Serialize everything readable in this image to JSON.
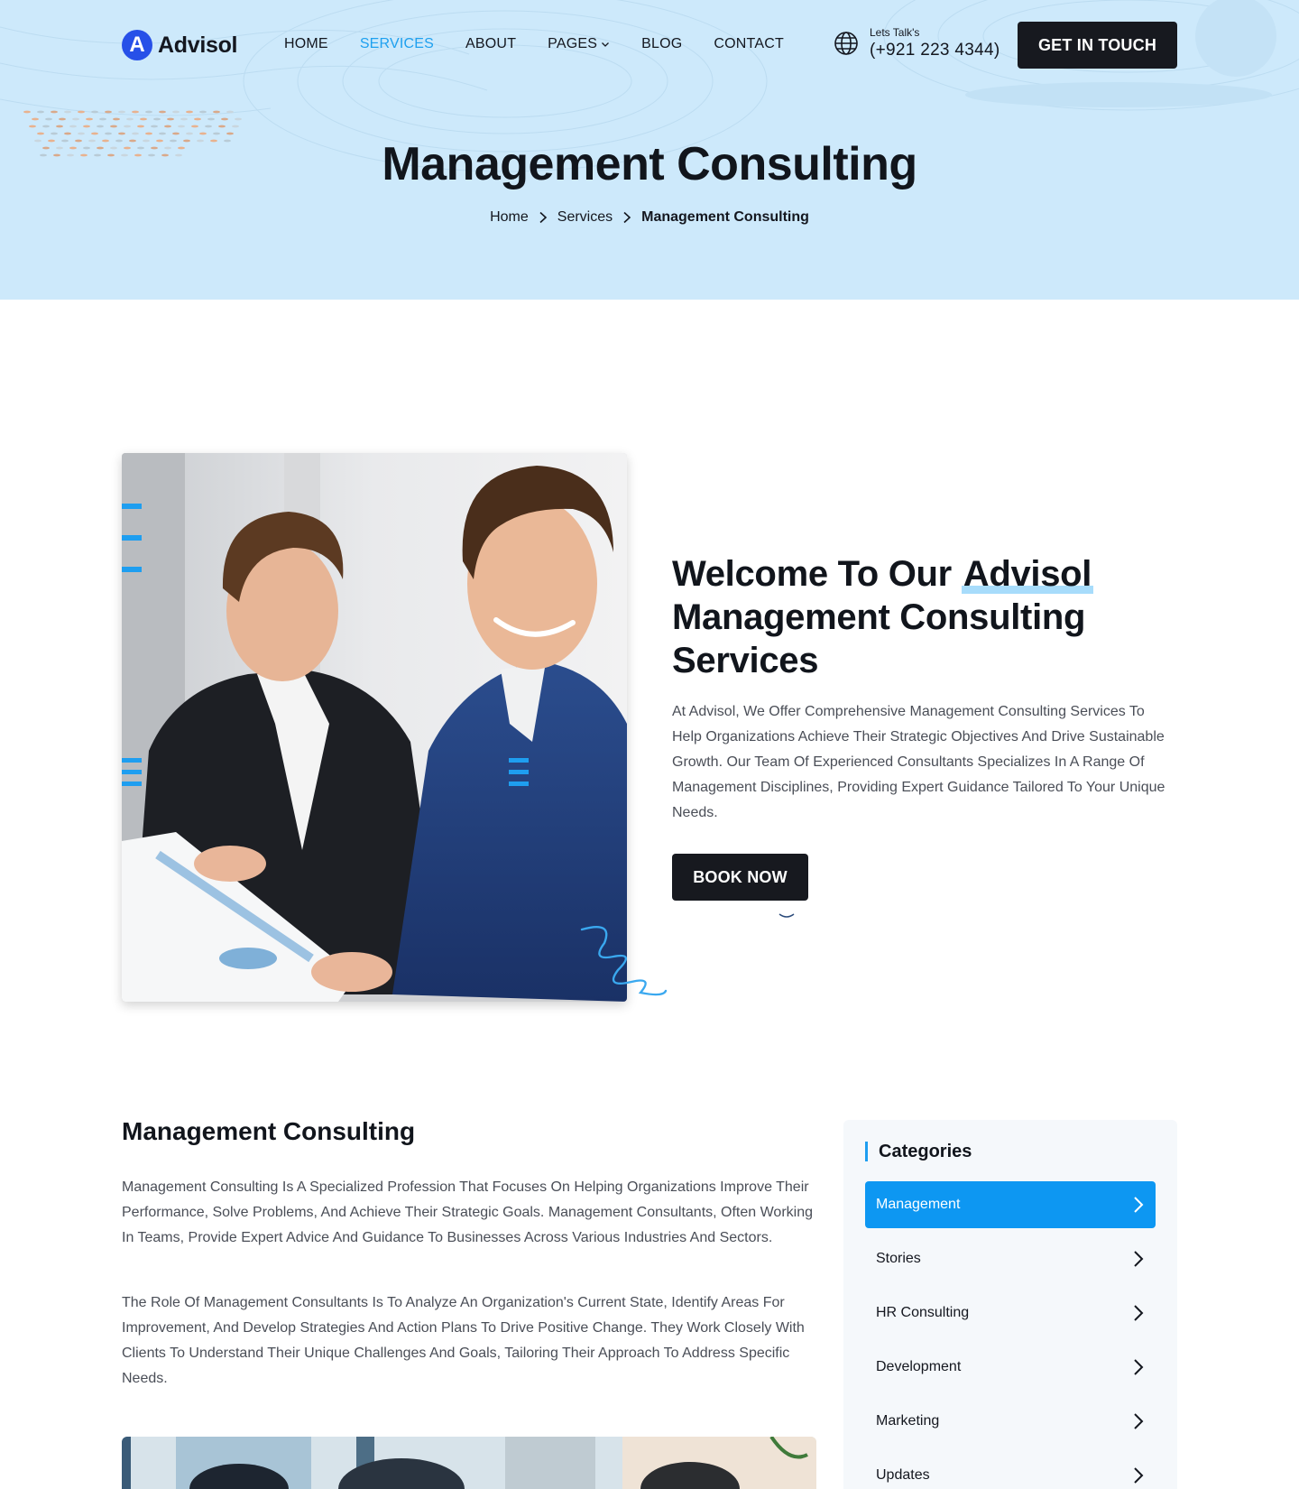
{
  "header": {
    "logo_letter": "A",
    "logo_text": "Advisol",
    "nav": [
      {
        "label": "HOME",
        "active": false
      },
      {
        "label": "SERVICES",
        "active": true
      },
      {
        "label": "ABOUT",
        "active": false
      },
      {
        "label": "PAGES",
        "active": false,
        "dropdown": true
      },
      {
        "label": "BLOG",
        "active": false
      },
      {
        "label": "CONTACT",
        "active": false
      }
    ],
    "contact_small": "Lets Talk's",
    "contact_phone": "(+921 223 4344)",
    "cta_label": "GET IN TOUCH"
  },
  "hero": {
    "title": "Management Consulting",
    "breadcrumb": [
      "Home",
      "Services",
      "Management Consulting"
    ]
  },
  "welcome": {
    "title_before": "Welcome To Our ",
    "title_highlight": "Advisol",
    "title_after": " Management Consulting Services",
    "description": "At Advisol, We Offer Comprehensive Management Consulting Services To Help Organizations Achieve Their Strategic Objectives And Drive Sustainable Growth. Our Team Of Experienced Consultants Specializes In A Range Of Management Disciplines, Providing Expert Guidance Tailored To Your Unique Needs.",
    "button_label": "BOOK NOW"
  },
  "detail": {
    "title": "Management Consulting",
    "paragraph1": "Management Consulting Is A Specialized Profession That Focuses On Helping Organizations Improve Their Performance, Solve Problems, And Achieve Their Strategic Goals. Management Consultants, Often Working In Teams, Provide Expert Advice And Guidance To Businesses Across Various Industries And Sectors.",
    "paragraph2": "The Role Of Management Consultants Is To Analyze An Organization's Current State, Identify Areas For Improvement, And Develop Strategies And Action Plans To Drive Positive Change. They Work Closely With Clients To Understand Their Unique Challenges And Goals, Tailoring Their Approach To Address Specific Needs."
  },
  "sidebar": {
    "title": "Categories",
    "items": [
      {
        "label": "Management",
        "active": true
      },
      {
        "label": "Stories",
        "active": false
      },
      {
        "label": "HR Consulting",
        "active": false
      },
      {
        "label": "Development",
        "active": false
      },
      {
        "label": "Marketing",
        "active": false
      },
      {
        "label": "Updates",
        "active": false
      }
    ]
  },
  "colors": {
    "hero_bg": "#cde9fb",
    "accent": "#1ea0ef",
    "active_category": "#0d97f2",
    "button_dark": "#17191f",
    "logo_blue": "#2750e8"
  },
  "icons": {
    "contact": "globe-icon",
    "breadcrumb_separator": "chevron-right-icon",
    "category_arrow": "chevron-right-icon",
    "pages_dropdown": "chevron-down-icon"
  }
}
